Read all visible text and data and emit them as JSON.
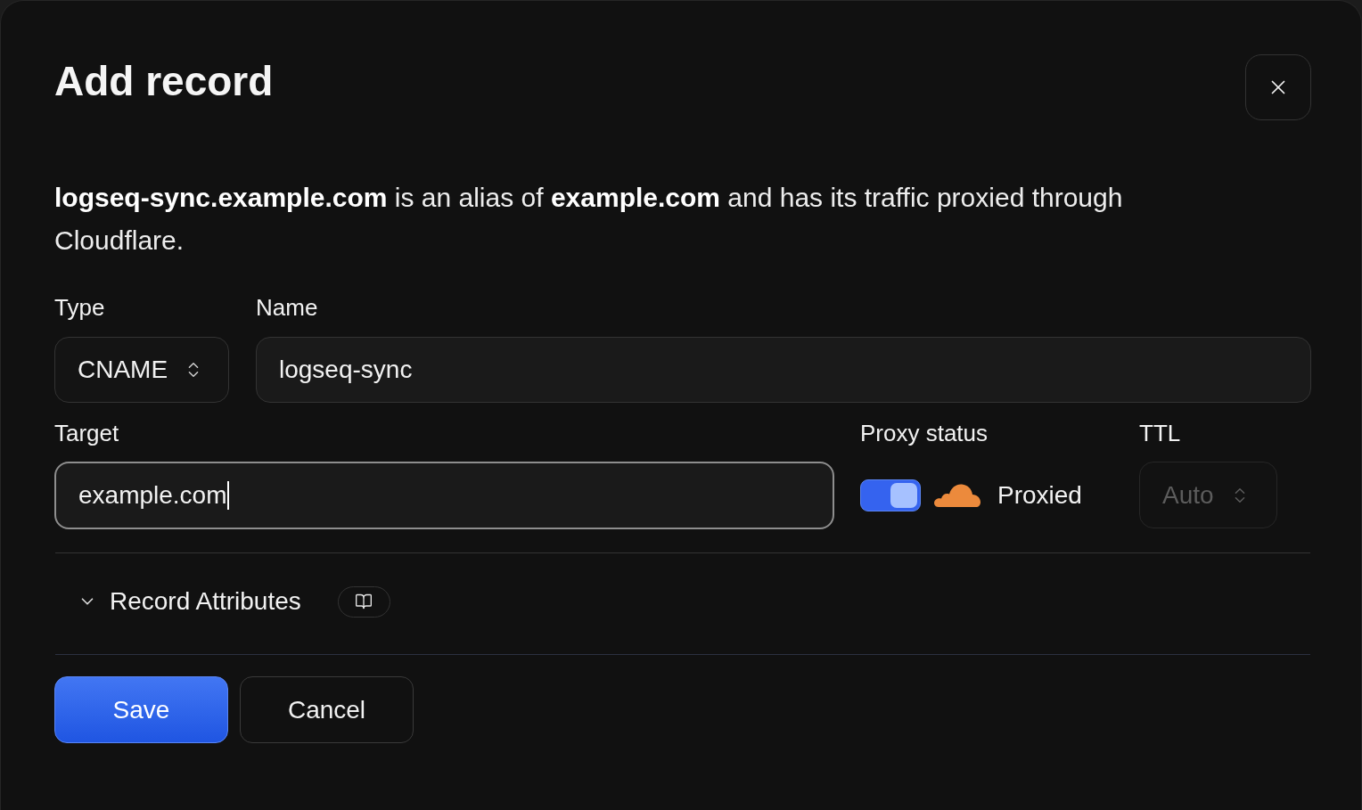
{
  "dialog": {
    "title": "Add record"
  },
  "description": "**logseq-sync.example.com** is an alias of **example.com** and has its traffic proxied through Cloudflare.",
  "type_select": {
    "label": "Type",
    "value": "CNAME"
  },
  "name_field": {
    "label": "Name",
    "value": "logseq-sync"
  },
  "target_field": {
    "label": "Target",
    "value": "example.com",
    "focused": true
  },
  "proxy_status": {
    "label": "Proxy status",
    "on": true,
    "text": "Proxied"
  },
  "ttl_select": {
    "label": "TTL",
    "value": "Auto",
    "disabled": true
  },
  "record_attributes": {
    "label": "Record Attributes",
    "expanded": false
  },
  "buttons": [
    {
      "label": "Save",
      "kind": "primary"
    },
    {
      "label": "Cancel",
      "kind": "secondary"
    }
  ]
}
